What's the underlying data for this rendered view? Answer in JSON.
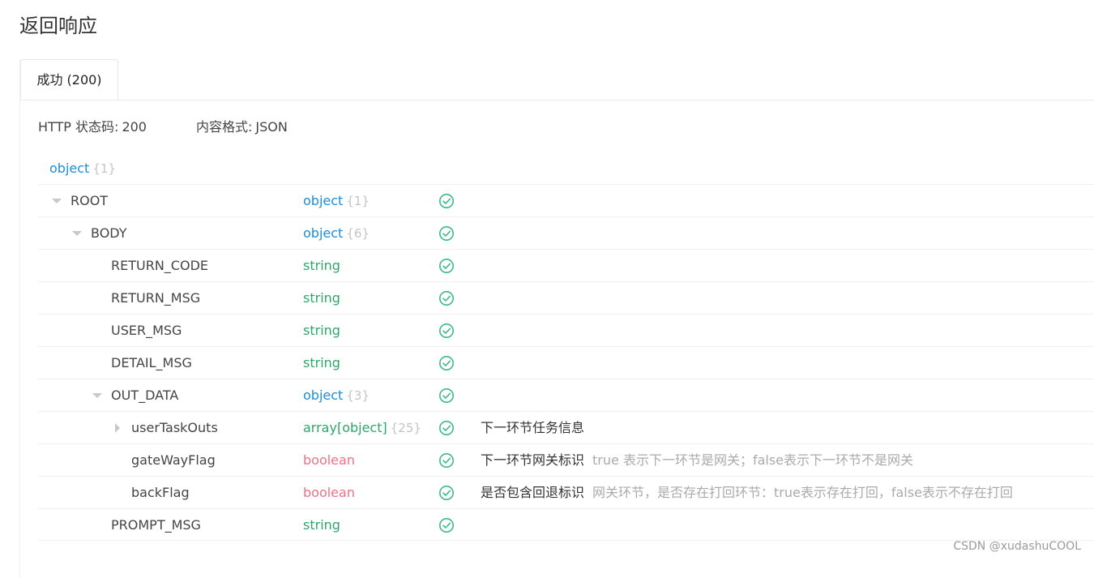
{
  "page_title": "返回响应",
  "tab": {
    "label": "成功 (200)"
  },
  "meta": {
    "status_label": "HTTP 状态码:",
    "status_value": "200",
    "format_label": "内容格式:",
    "format_value": "JSON"
  },
  "schema_root": {
    "type": "object",
    "count": "{1}"
  },
  "rows": [
    {
      "name": "ROOT",
      "type": "object",
      "count": "{1}",
      "desc": "",
      "note": ""
    },
    {
      "name": "BODY",
      "type": "object",
      "count": "{6}",
      "desc": "",
      "note": ""
    },
    {
      "name": "RETURN_CODE",
      "type": "string",
      "count": "",
      "desc": "",
      "note": ""
    },
    {
      "name": "RETURN_MSG",
      "type": "string",
      "count": "",
      "desc": "",
      "note": ""
    },
    {
      "name": "USER_MSG",
      "type": "string",
      "count": "",
      "desc": "",
      "note": ""
    },
    {
      "name": "DETAIL_MSG",
      "type": "string",
      "count": "",
      "desc": "",
      "note": ""
    },
    {
      "name": "OUT_DATA",
      "type": "object",
      "count": "{3}",
      "desc": "",
      "note": ""
    },
    {
      "name": "userTaskOuts",
      "type": "array[object]",
      "count": "{25}",
      "desc": "下一环节任务信息",
      "note": ""
    },
    {
      "name": "gateWayFlag",
      "type": "boolean",
      "count": "",
      "desc": "下一环节网关标识",
      "note": "true 表示下一环节是网关；false表示下一环节不是网关"
    },
    {
      "name": "backFlag",
      "type": "boolean",
      "count": "",
      "desc": "是否包含回退标识",
      "note": "网关环节，是否存在打回环节：true表示存在打回，false表示不存在打回"
    },
    {
      "name": "PROMPT_MSG",
      "type": "string",
      "count": "",
      "desc": "",
      "note": ""
    }
  ],
  "colors": {
    "object": "#1a8fd8",
    "string": "#2da76a",
    "boolean": "#f0708a",
    "check": "#3cb98a"
  },
  "icons": {
    "required": "check-circle-icon",
    "collapse": "caret-down-icon",
    "expand": "caret-right-icon"
  },
  "watermark": "CSDN @xudashuCOOL"
}
